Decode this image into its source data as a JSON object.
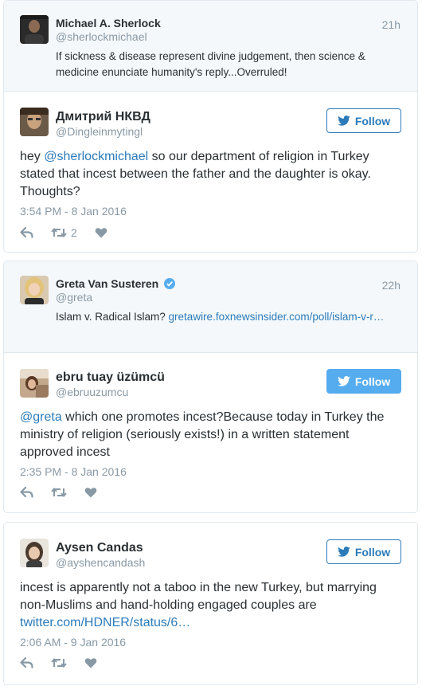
{
  "cards": [
    {
      "quoted": {
        "name": "Michael A. Sherlock",
        "handle": "@sherlockmichael",
        "time": "21h",
        "text": "If sickness & disease represent divine judgement, then science & medicine enunciate humanity's reply...Overruled!"
      },
      "reply": {
        "name": "Дмитрий НКВД",
        "handle": "@Dingleinmytingl",
        "follow_label": "Follow",
        "text_prefix": "hey ",
        "mention": "@sherlockmichael",
        "text_rest": "  so our department of religion in Turkey stated that incest  between the father and the daughter is okay. Thoughts?",
        "timestamp": "3:54 PM - 8 Jan 2016",
        "retweet_count": "2"
      }
    },
    {
      "quoted": {
        "name": "Greta Van Susteren",
        "handle": "@greta",
        "time": "22h",
        "text_prefix": "Islam v. Radical Islam? ",
        "link": "gretawire.foxnewsinsider.com/poll/islam-v-r…"
      },
      "reply": {
        "name": "ebru tuay üzümcü",
        "handle": "@ebruuzumcu",
        "follow_label": "Follow",
        "mention": "@greta",
        "text_rest": " which one promotes incest?Because today in Turkey the ministry of religion (seriously exists!) in a written statement approved incest",
        "timestamp": "2:35 PM - 8 Jan 2016"
      }
    },
    {
      "reply": {
        "name": "Aysen Candas",
        "handle": "@ayshencandash",
        "follow_label": "Follow",
        "text": "incest is apparently not a taboo in the new Turkey, but marrying non-Muslims and hand-holding engaged couples are ",
        "link": "twitter.com/HDNER/status/6…",
        "timestamp": "2:06 AM - 9 Jan 2016"
      }
    }
  ],
  "colors": {
    "link": "#2b7bb9",
    "muted": "#8899a6",
    "follow_filled": "#55acee",
    "quoted_bg": "#f5f8fa",
    "verified": "#55acee"
  },
  "icons": [
    "reply-icon",
    "retweet-icon",
    "like-icon",
    "twitter-bird-icon",
    "verified-badge-icon"
  ]
}
